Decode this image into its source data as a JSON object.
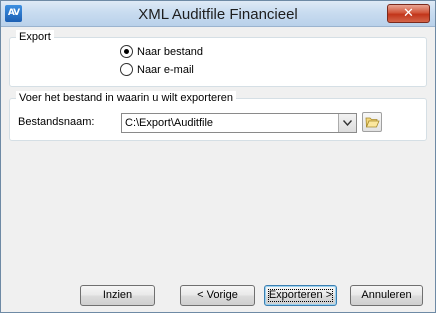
{
  "window": {
    "title": "XML Auditfile Financieel",
    "close_label": "✕"
  },
  "export_group": {
    "legend": "Export",
    "options": [
      {
        "label": "Naar bestand",
        "checked": true
      },
      {
        "label": "Naar e-mail",
        "checked": false
      }
    ]
  },
  "file_group": {
    "legend": "Voer het bestand in waarin u wilt exporteren",
    "field_label": "Bestandsnaam:",
    "path_value": "C:\\Export\\Auditfile"
  },
  "buttons": {
    "view": "Inzien",
    "back": "< Vorige",
    "export": "Exporteren >",
    "cancel": "Annuleren"
  },
  "icons": {
    "app": "app-logo-icon",
    "dropdown": "chevron-down-icon",
    "browse": "folder-open-icon"
  }
}
